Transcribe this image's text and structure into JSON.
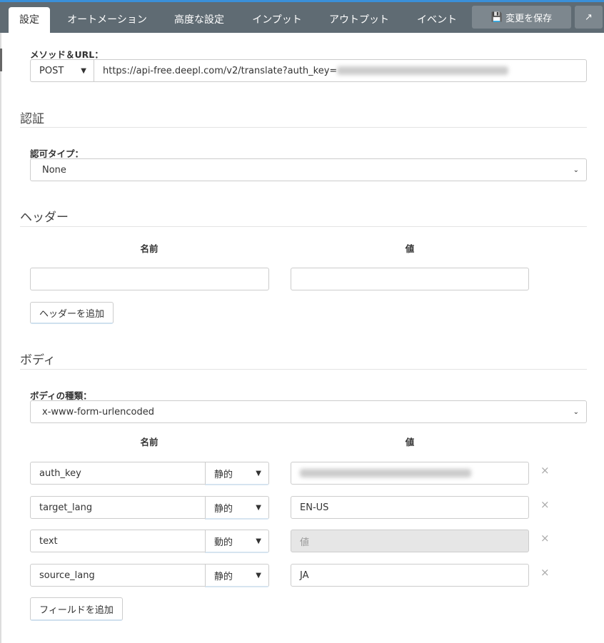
{
  "tabs": [
    "設定",
    "オートメーション",
    "高度な設定",
    "インプット",
    "アウトプット",
    "イベント"
  ],
  "save_label": "変更を保存",
  "method_url": {
    "label": "メソッド＆URL：",
    "method": "POST",
    "url": "https://api-free.deepl.com/v2/translate?auth_key="
  },
  "auth": {
    "title": "認証",
    "type_label": "認可タイプ：",
    "type_value": "None"
  },
  "headers": {
    "title": "ヘッダー",
    "name_col": "名前",
    "value_col": "値",
    "add_label": "ヘッダーを追加"
  },
  "body": {
    "title": "ボディ",
    "type_label": "ボディの種類：",
    "type_value": "x-www-form-urlencoded",
    "name_col": "名前",
    "value_col": "値",
    "fields": [
      {
        "name": "auth_key",
        "mode": "静的",
        "value": ""
      },
      {
        "name": "target_lang",
        "mode": "静的",
        "value": "EN-US"
      },
      {
        "name": "text",
        "mode": "動的",
        "placeholder": "値"
      },
      {
        "name": "source_lang",
        "mode": "静的",
        "value": "JA"
      }
    ],
    "add_label": "フィールドを追加"
  }
}
